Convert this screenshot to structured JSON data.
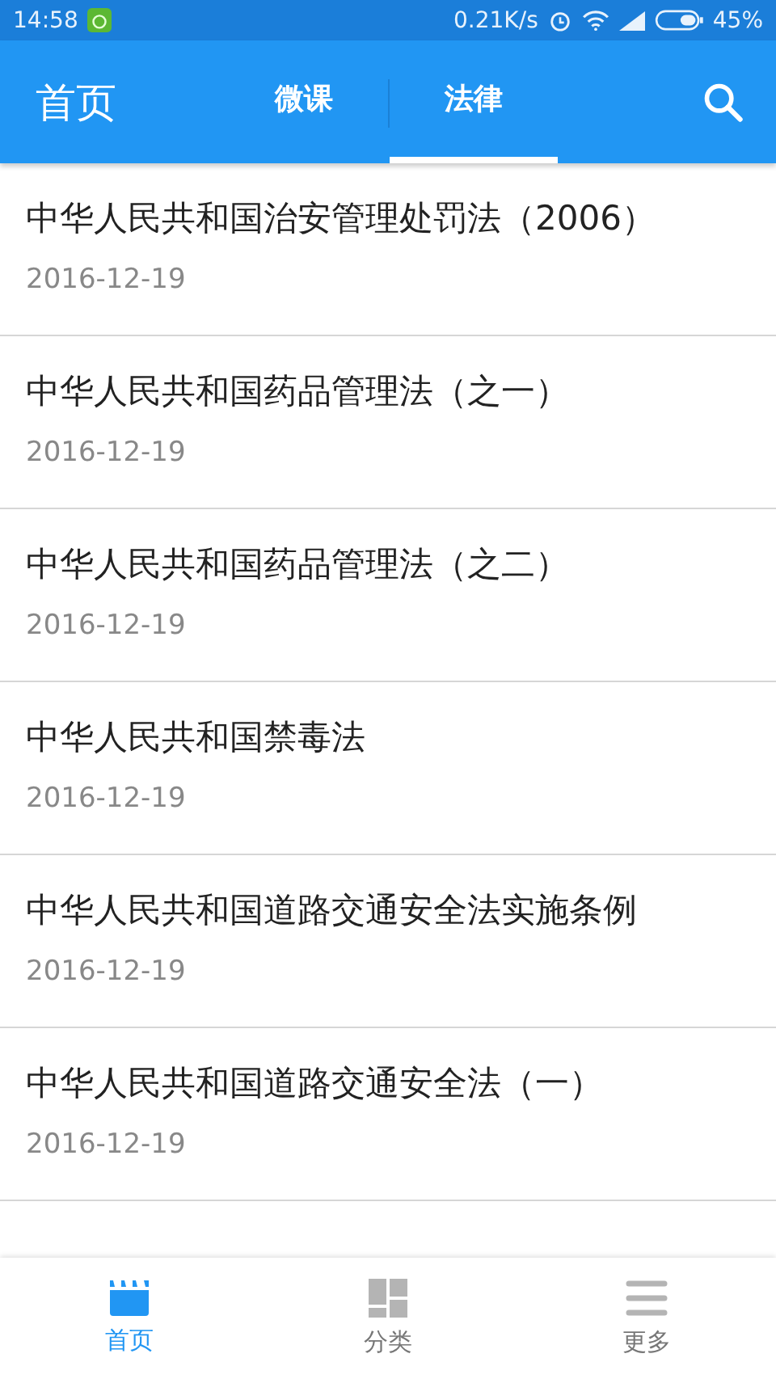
{
  "status_bar": {
    "time": "14:58",
    "speed": "0.21K/s",
    "battery": "45%"
  },
  "header": {
    "title": "首页",
    "tabs": [
      {
        "label": "微课",
        "selected": false
      },
      {
        "label": "法律",
        "selected": true
      }
    ]
  },
  "items": [
    {
      "title": "中华人民共和国治安管理处罚法（2006）",
      "date": "2016-12-19"
    },
    {
      "title": "中华人民共和国药品管理法（之一）",
      "date": "2016-12-19"
    },
    {
      "title": "中华人民共和国药品管理法（之二）",
      "date": "2016-12-19"
    },
    {
      "title": "中华人民共和国禁毒法",
      "date": "2016-12-19"
    },
    {
      "title": "中华人民共和国道路交通安全法实施条例",
      "date": "2016-12-19"
    },
    {
      "title": "中华人民共和国道路交通安全法（一）",
      "date": "2016-12-19"
    }
  ],
  "bottom_nav": [
    {
      "label": "首页",
      "kind": "film",
      "selected": true
    },
    {
      "label": "分类",
      "kind": "grid",
      "selected": false
    },
    {
      "label": "更多",
      "kind": "menu",
      "selected": false
    }
  ]
}
